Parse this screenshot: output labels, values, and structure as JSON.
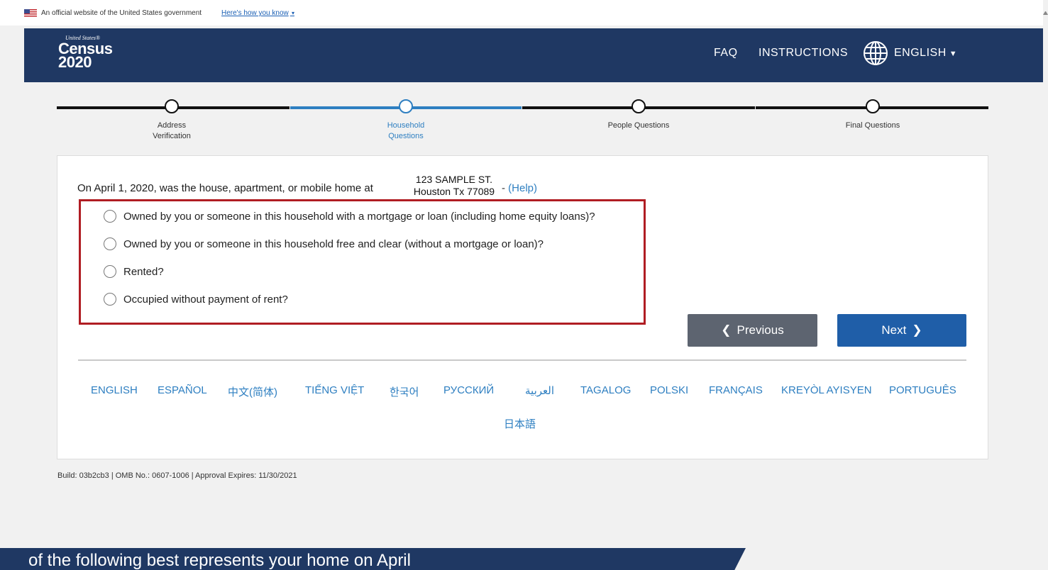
{
  "gov_banner": {
    "text": "An official website of the United States government",
    "link": "Here's how you know"
  },
  "header": {
    "logo_top": "United States®",
    "logo_main": "Census",
    "logo_year": "2020",
    "nav": {
      "faq": "FAQ",
      "instructions": "INSTRUCTIONS",
      "language": "ENGLISH"
    }
  },
  "progress": {
    "steps": [
      {
        "label": "Address Verification",
        "status": "complete"
      },
      {
        "label": "Household Questions",
        "status": "current"
      },
      {
        "label": "People Questions",
        "status": "upcoming"
      },
      {
        "label": "Final Questions",
        "status": "upcoming"
      }
    ]
  },
  "question": {
    "text": "On April 1, 2020, was the house, apartment, or mobile home at",
    "address_line1": "123 SAMPLE ST.",
    "address_line2": "Houston Tx 77089",
    "separator": "- ",
    "help_label": "(Help)"
  },
  "options": [
    "Owned by you or someone in this household with a mortgage or loan (including home equity loans)?",
    "Owned by you or someone in this household free and clear (without a mortgage or loan)?",
    "Rented?",
    "Occupied without payment of rent?"
  ],
  "buttons": {
    "previous": "Previous",
    "next": "Next"
  },
  "languages": [
    "ENGLISH",
    "ESPAÑOL",
    "中文(简体)",
    "TIẾNG VIỆT",
    "한국어",
    "РУССКИЙ",
    "العربية",
    "TAGALOG",
    "POLSKI",
    "FRANÇAIS",
    "KREYÒL AYISYEN",
    "PORTUGUÊS",
    "日本語"
  ],
  "footer": "Build: 03b2cb3 | OMB No.: 0607-1006 | Approval Expires: 11/30/2021",
  "caption": "of the following best represents your home on April",
  "colors": {
    "header_bg": "#1f3863",
    "accent_blue": "#2e7fc1",
    "highlight_red": "#b01d23",
    "previous_btn": "#5d6470",
    "next_btn": "#1f5ea8"
  }
}
